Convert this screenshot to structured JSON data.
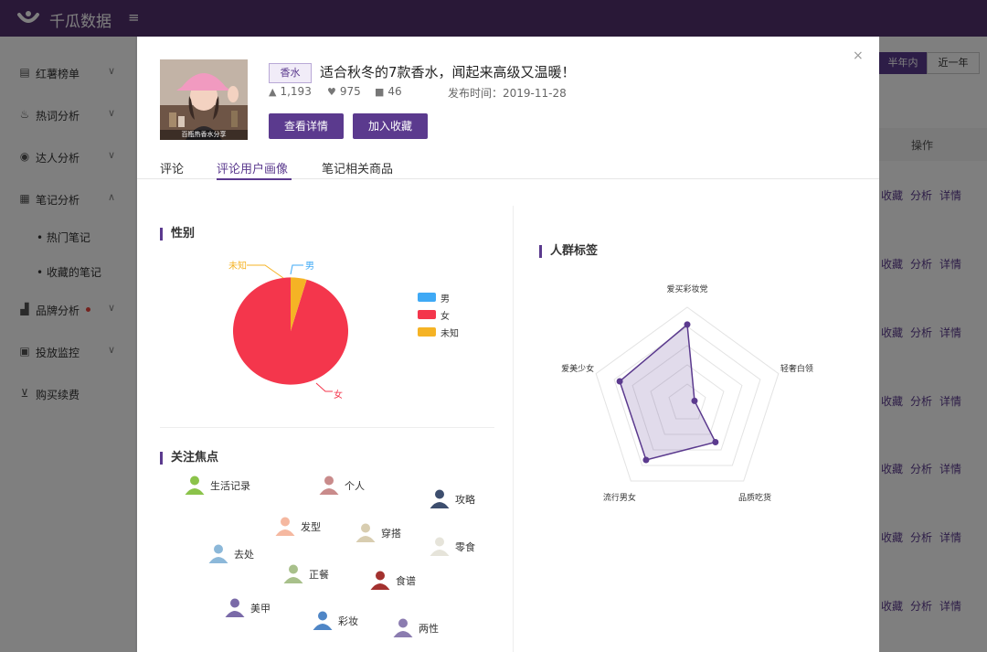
{
  "app": {
    "brand": "千瓜数据",
    "collapse_icon": "indent-icon"
  },
  "sidebar": {
    "items": [
      {
        "label": "红薯榜单",
        "icon": "list-icon"
      },
      {
        "label": "热词分析",
        "icon": "fire-icon"
      },
      {
        "label": "达人分析",
        "icon": "user-circle-icon"
      },
      {
        "label": "笔记分析",
        "icon": "note-icon"
      },
      {
        "label": "品牌分析",
        "icon": "chart-icon"
      },
      {
        "label": "投放监控",
        "icon": "monitor-icon"
      },
      {
        "label": "购买续费",
        "icon": "cart-icon"
      }
    ],
    "subitems": [
      {
        "label": "• 热门笔记"
      },
      {
        "label": "• 收藏的笔记"
      }
    ]
  },
  "background": {
    "segments": [
      "半年内",
      "近一年"
    ],
    "table_header": "操作",
    "row_actions": [
      "收藏",
      "分析",
      "详情"
    ]
  },
  "modal": {
    "close": "×",
    "thumbnail_caption": "百瓶热香水分享",
    "tag": "香水",
    "title": "适合秋冬的7款香水，闻起来高级又温暖！",
    "stats": {
      "likes": "1,193",
      "favorites": "975",
      "comments": "46"
    },
    "publish_time": "发布时间：2019-11-28",
    "buttons": {
      "detail": "查看详情",
      "collect": "加入收藏"
    },
    "tabs": [
      "评论",
      "评论用户画像",
      "笔记相关商品"
    ],
    "active_tab": 1,
    "gender": {
      "title": "性别",
      "legend": [
        {
          "label": "男",
          "color": "#3fa9f5"
        },
        {
          "label": "女",
          "color": "#f4364c"
        },
        {
          "label": "未知",
          "color": "#f5b325"
        }
      ]
    },
    "focus": {
      "title": "关注焦点",
      "items": [
        {
          "label": "生活记录",
          "color": "#8bc34a"
        },
        {
          "label": "个人",
          "color": "#c98b8b"
        },
        {
          "label": "攻略",
          "color": "#3d4e6e"
        },
        {
          "label": "发型",
          "color": "#f5b8a0"
        },
        {
          "label": "穿搭",
          "color": "#d8cdb0"
        },
        {
          "label": "零食",
          "color": "#e6e4da"
        },
        {
          "label": "去处",
          "color": "#8cb8d9"
        },
        {
          "label": "正餐",
          "color": "#a8c08b"
        },
        {
          "label": "食谱",
          "color": "#a3312f"
        },
        {
          "label": "美甲",
          "color": "#7a6aa8"
        },
        {
          "label": "彩妆",
          "color": "#4f86c6"
        },
        {
          "label": "两性",
          "color": "#8b7cb0"
        }
      ]
    },
    "crowd": {
      "title": "人群标签"
    }
  },
  "chart_data": [
    {
      "type": "pie",
      "title": "性别",
      "series": [
        {
          "name": "男",
          "value": 0
        },
        {
          "name": "女",
          "value": 95.5
        },
        {
          "name": "未知",
          "value": 4.5
        }
      ],
      "colors": [
        "#3fa9f5",
        "#f4364c",
        "#f5b325"
      ],
      "legend": "right",
      "unit": "%"
    },
    {
      "type": "radar",
      "title": "人群标签",
      "indicators": [
        "爱买彩妆党",
        "轻奢白领",
        "品质吃货",
        "流行男女",
        "爱美少女"
      ],
      "values": [
        0.82,
        0.08,
        0.5,
        0.73,
        0.74
      ],
      "color": "#5b3a8e",
      "max": 1
    }
  ]
}
